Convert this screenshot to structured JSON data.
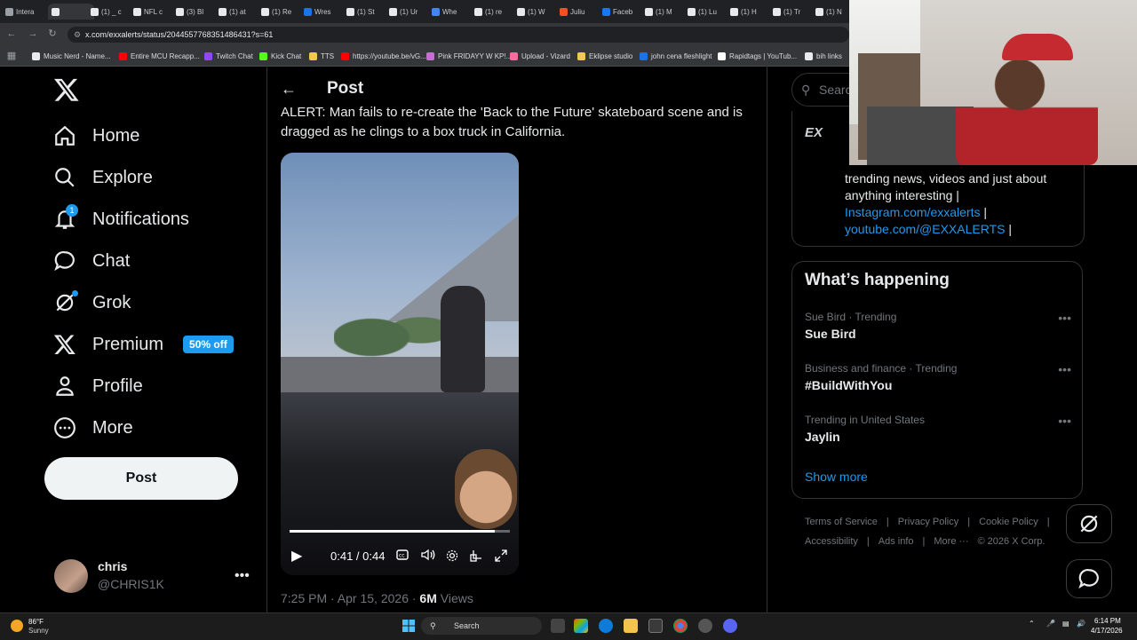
{
  "browser": {
    "tabs": [
      "Intera",
      "",
      "(1) _ c",
      "NFL c",
      "(3) Bl",
      "(1) at",
      "(1) Re",
      "Wres",
      "(1) St",
      "(1) Ur",
      "Whe",
      "(1) re",
      "(1) W",
      "Juliu",
      "Faceb",
      "(1) M",
      "(1) Lu",
      "(1) H",
      "(1) Tr",
      "(1) N"
    ],
    "url": "x.com/exxalerts/status/2044557768351486431?s=61",
    "bookmarks": [
      "Music Nerd - Name...",
      "Entire MCU Recapp...",
      "Twitch Chat",
      "Kick Chat",
      "TTS",
      "https://youtube.be/vG...",
      "Pink FRIDAYY W KP!...",
      "Upload - Vizard",
      "Eklipse studio",
      "john cena fleshlight",
      "Rapidtags | YouTub...",
      "bih links"
    ]
  },
  "nav": {
    "home": "Home",
    "explore": "Explore",
    "notifications": "Notifications",
    "notifications_badge": "1",
    "chat": "Chat",
    "grok": "Grok",
    "premium": "Premium",
    "premium_badge": "50% off",
    "profile": "Profile",
    "more": "More",
    "post_button": "Post"
  },
  "account": {
    "name": "chris",
    "handle": "@CHRIS1K",
    "more": "•••"
  },
  "post": {
    "header": "Post",
    "text": "ALERT: Man fails to re-create the 'Back to the Future' skateboard scene and is dragged as he clings to a box truck in California.",
    "video_time": "0:41 / 0:44",
    "video_progress": 0.93,
    "timestamp": "7:25 PM · Apr 15, 2026 · ",
    "views_count": "6M",
    "views_label": " Views"
  },
  "sidebar": {
    "search_placeholder": "Search",
    "bio_text": "trending news, videos and just about anything interesting |",
    "bio_link1": "Instagram.com/exxalerts",
    "bio_sep1": " |",
    "bio_link2": "youtube.com/@EXXALERTS",
    "bio_sep2": " |",
    "happening_title": "What’s happening",
    "trends": [
      {
        "context": "Sue Bird · Trending",
        "name": "Sue Bird"
      },
      {
        "context": "Business and finance · Trending",
        "name": "#BuildWithYou"
      },
      {
        "context": "Trending in United States",
        "name": "Jaylin"
      }
    ],
    "show_more": "Show more",
    "footer_row1": [
      "Terms of Service",
      "|",
      "Privacy Policy",
      "|",
      "Cookie Policy",
      "|"
    ],
    "footer_row2": [
      "Accessibility",
      "|",
      "Ads info",
      "|",
      "More ···",
      "© 2026 X Corp."
    ]
  },
  "taskbar": {
    "weather_temp": "86°F",
    "weather_desc": "Sunny",
    "search": "Search",
    "time": "6:14 PM",
    "date": "4/17/2026"
  }
}
